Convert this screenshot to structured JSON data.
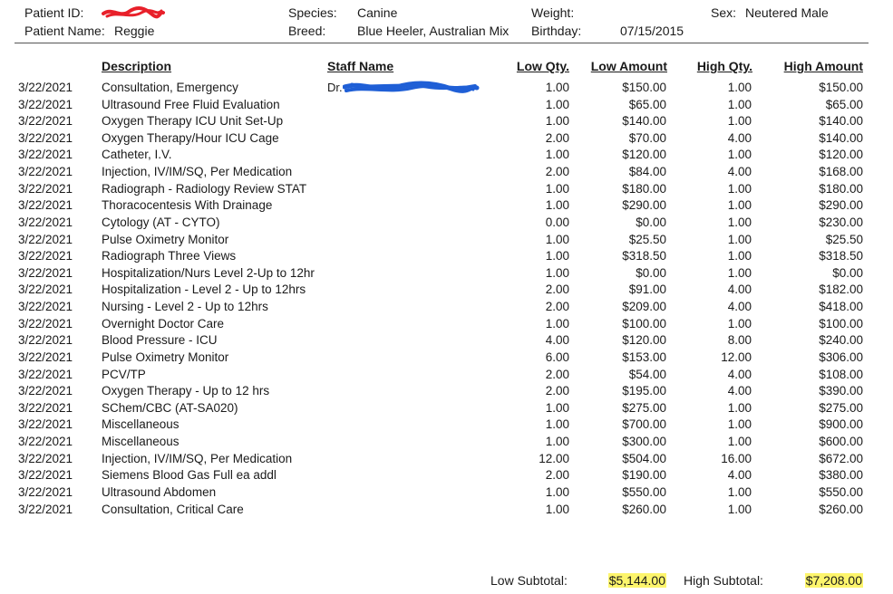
{
  "patient": {
    "id_label": "Patient ID:",
    "name_label": "Patient Name:",
    "name": "Reggie",
    "species_label": "Species:",
    "species": "Canine",
    "breed_label": "Breed:",
    "breed": "Blue Heeler, Australian Mix",
    "weight_label": "Weight:",
    "birthday_label": "Birthday:",
    "birthday": "07/15/2015",
    "sex_label": "Sex:",
    "sex": "Neutered Male"
  },
  "columns": {
    "description": "Description",
    "staff": "Staff Name",
    "low_qty": "Low Qty.",
    "low_amount": "Low Amount",
    "high_qty": "High Qty.",
    "high_amount": "High Amount"
  },
  "staff_prefix": "Dr.",
  "rows": [
    {
      "date": "3/22/2021",
      "desc": "Consultation, Emergency",
      "lq": "1.00",
      "la": "$150.00",
      "hq": "1.00",
      "ha": "$150.00"
    },
    {
      "date": "3/22/2021",
      "desc": "Ultrasound Free Fluid Evaluation",
      "lq": "1.00",
      "la": "$65.00",
      "hq": "1.00",
      "ha": "$65.00"
    },
    {
      "date": "3/22/2021",
      "desc": "Oxygen Therapy ICU Unit Set-Up",
      "lq": "1.00",
      "la": "$140.00",
      "hq": "1.00",
      "ha": "$140.00"
    },
    {
      "date": "3/22/2021",
      "desc": "Oxygen Therapy/Hour ICU Cage",
      "lq": "2.00",
      "la": "$70.00",
      "hq": "4.00",
      "ha": "$140.00"
    },
    {
      "date": "3/22/2021",
      "desc": "Catheter, I.V.",
      "lq": "1.00",
      "la": "$120.00",
      "hq": "1.00",
      "ha": "$120.00"
    },
    {
      "date": "3/22/2021",
      "desc": "Injection, IV/IM/SQ, Per Medication",
      "lq": "2.00",
      "la": "$84.00",
      "hq": "4.00",
      "ha": "$168.00"
    },
    {
      "date": "3/22/2021",
      "desc": "Radiograph - Radiology Review STAT",
      "lq": "1.00",
      "la": "$180.00",
      "hq": "1.00",
      "ha": "$180.00"
    },
    {
      "date": "3/22/2021",
      "desc": "Thoracocentesis With Drainage",
      "lq": "1.00",
      "la": "$290.00",
      "hq": "1.00",
      "ha": "$290.00"
    },
    {
      "date": "3/22/2021",
      "desc": "Cytology (AT - CYTO)",
      "lq": "0.00",
      "la": "$0.00",
      "hq": "1.00",
      "ha": "$230.00"
    },
    {
      "date": "3/22/2021",
      "desc": "Pulse Oximetry Monitor",
      "lq": "1.00",
      "la": "$25.50",
      "hq": "1.00",
      "ha": "$25.50"
    },
    {
      "date": "3/22/2021",
      "desc": "Radiograph Three Views",
      "lq": "1.00",
      "la": "$318.50",
      "hq": "1.00",
      "ha": "$318.50"
    },
    {
      "date": "3/22/2021",
      "desc": "Hospitalization/Nurs Level 2-Up to 12hr",
      "lq": "1.00",
      "la": "$0.00",
      "hq": "1.00",
      "ha": "$0.00"
    },
    {
      "date": "3/22/2021",
      "desc": "Hospitalization - Level 2 - Up to 12hrs",
      "lq": "2.00",
      "la": "$91.00",
      "hq": "4.00",
      "ha": "$182.00"
    },
    {
      "date": "3/22/2021",
      "desc": "Nursing - Level 2 - Up to 12hrs",
      "lq": "2.00",
      "la": "$209.00",
      "hq": "4.00",
      "ha": "$418.00"
    },
    {
      "date": "3/22/2021",
      "desc": "Overnight Doctor Care",
      "lq": "1.00",
      "la": "$100.00",
      "hq": "1.00",
      "ha": "$100.00"
    },
    {
      "date": "3/22/2021",
      "desc": "Blood Pressure - ICU",
      "lq": "4.00",
      "la": "$120.00",
      "hq": "8.00",
      "ha": "$240.00"
    },
    {
      "date": "3/22/2021",
      "desc": "Pulse Oximetry Monitor",
      "lq": "6.00",
      "la": "$153.00",
      "hq": "12.00",
      "ha": "$306.00"
    },
    {
      "date": "3/22/2021",
      "desc": "PCV/TP",
      "lq": "2.00",
      "la": "$54.00",
      "hq": "4.00",
      "ha": "$108.00"
    },
    {
      "date": "3/22/2021",
      "desc": "Oxygen Therapy - Up to 12 hrs",
      "lq": "2.00",
      "la": "$195.00",
      "hq": "4.00",
      "ha": "$390.00"
    },
    {
      "date": "3/22/2021",
      "desc": "SChem/CBC (AT-SA020)",
      "lq": "1.00",
      "la": "$275.00",
      "hq": "1.00",
      "ha": "$275.00"
    },
    {
      "date": "3/22/2021",
      "desc": "Miscellaneous",
      "lq": "1.00",
      "la": "$700.00",
      "hq": "1.00",
      "ha": "$900.00"
    },
    {
      "date": "3/22/2021",
      "desc": "Miscellaneous",
      "lq": "1.00",
      "la": "$300.00",
      "hq": "1.00",
      "ha": "$600.00"
    },
    {
      "date": "3/22/2021",
      "desc": "Injection, IV/IM/SQ, Per Medication",
      "lq": "12.00",
      "la": "$504.00",
      "hq": "16.00",
      "ha": "$672.00"
    },
    {
      "date": "3/22/2021",
      "desc": "Siemens Blood Gas Full ea addl",
      "lq": "2.00",
      "la": "$190.00",
      "hq": "4.00",
      "ha": "$380.00"
    },
    {
      "date": "3/22/2021",
      "desc": "Ultrasound Abdomen",
      "lq": "1.00",
      "la": "$550.00",
      "hq": "1.00",
      "ha": "$550.00"
    },
    {
      "date": "3/22/2021",
      "desc": "Consultation, Critical Care",
      "lq": "1.00",
      "la": "$260.00",
      "hq": "1.00",
      "ha": "$260.00"
    }
  ],
  "totals": {
    "low_label": "Low Subtotal:",
    "low_value": "$5,144.00",
    "high_label": "High Subtotal:",
    "high_value": "$7,208.00",
    "highlight_color": "#fdf56c"
  },
  "redaction": {
    "patient_id_color": "#e8202a",
    "staff_color": "#1f5fd6"
  }
}
